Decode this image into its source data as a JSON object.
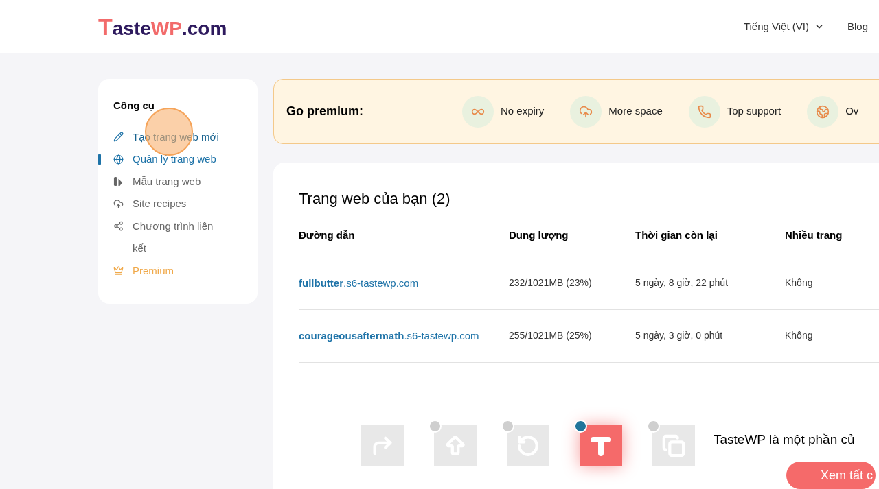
{
  "header": {
    "logo": {
      "initial": "T",
      "middle": "aste",
      "accent": "WP",
      "suffix": ".com"
    },
    "language": "Tiếng Việt (VI)",
    "nav": [
      "Blog"
    ]
  },
  "sidebar": {
    "title": "Công cụ",
    "items": [
      {
        "label": "Tạo trang web mới",
        "kind": "pencil",
        "selected": false,
        "hovered": true
      },
      {
        "label": "Quản lý trang web",
        "kind": "globe",
        "selected": true,
        "hovered": false
      },
      {
        "label": "Mẫu trang web",
        "kind": "templates",
        "selected": false,
        "hovered": false
      },
      {
        "label": "Site recipes",
        "kind": "cloud",
        "selected": false,
        "hovered": false
      },
      {
        "label": "Chương trình liên kết",
        "kind": "share",
        "selected": false,
        "hovered": false
      },
      {
        "label": "Premium",
        "kind": "crown",
        "selected": false,
        "hovered": false
      }
    ]
  },
  "premium": {
    "title": "Go premium:",
    "features": [
      {
        "label": "No expiry",
        "kind": "infinity"
      },
      {
        "label": "More space",
        "kind": "cloud"
      },
      {
        "label": "Top support",
        "kind": "phone"
      },
      {
        "label": "Ov",
        "kind": "www"
      }
    ]
  },
  "sites": {
    "title": "Trang web của bạn (2)",
    "columns": [
      "Đường dẫn",
      "Dung lượng",
      "Thời gian còn lại",
      "Nhiều trang"
    ],
    "rows": [
      {
        "url": "**fullbutter**.s6-tastewp.com",
        "space": "232/1021MB (23%)",
        "time": "5 ngày, 8 giờ, 22 phút",
        "multisite": "Không"
      },
      {
        "url": "**courageousaftermath**.s6-tastewp.com",
        "space": "255/1021MB (25%)",
        "time": "5 ngày, 3 giờ, 0 phút",
        "multisite": "Không"
      }
    ]
  },
  "products": {
    "tiles": [
      {
        "kind": "arrow",
        "wp_badge": false,
        "selected": false
      },
      {
        "kind": "upload",
        "wp_badge": true,
        "selected": false
      },
      {
        "kind": "backup",
        "wp_badge": true,
        "selected": false
      },
      {
        "kind": "tastewp",
        "wp_badge": true,
        "selected": true
      },
      {
        "kind": "copy",
        "wp_badge": true,
        "selected": false
      }
    ],
    "text": "TasteWP là một phần củ",
    "button": "Xem tất c"
  }
}
